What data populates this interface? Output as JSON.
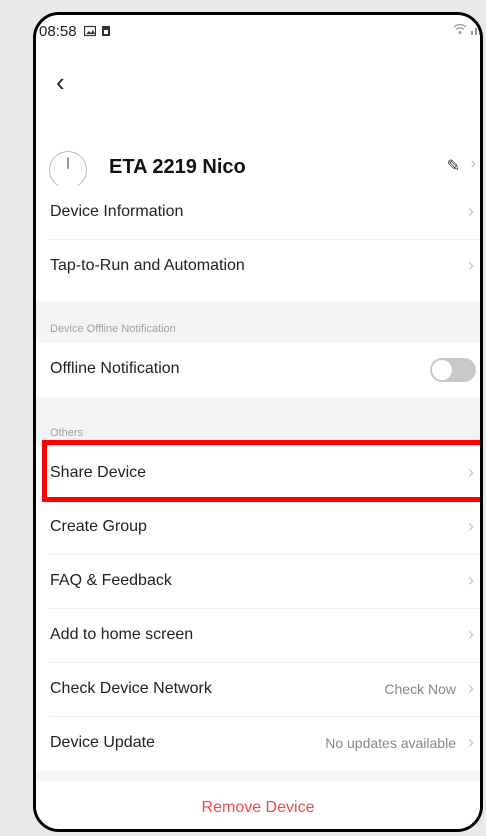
{
  "status_bar": {
    "time": "08:58"
  },
  "device": {
    "name": "ETA 2219 Nico"
  },
  "menu_top": [
    {
      "label": "Device Information"
    },
    {
      "label": "Tap-to-Run and Automation"
    }
  ],
  "section_offline": {
    "title": "Device Offline Notification",
    "item_label": "Offline Notification",
    "toggle_on": false
  },
  "section_others": {
    "title": "Others",
    "items": [
      {
        "label": "Share Device",
        "value": ""
      },
      {
        "label": "Create Group",
        "value": ""
      },
      {
        "label": "FAQ & Feedback",
        "value": ""
      },
      {
        "label": "Add to home screen",
        "value": ""
      },
      {
        "label": "Check Device Network",
        "value": "Check Now"
      },
      {
        "label": "Device Update",
        "value": "No updates available"
      }
    ]
  },
  "remove": {
    "label": "Remove Device"
  },
  "colors": {
    "highlight": "#ff0000",
    "danger": "#f04b4b",
    "toggle_off": "#c8c8c8"
  },
  "icons": [
    "back-icon",
    "edit-icon",
    "chevron-right-icon",
    "wifi-icon",
    "signal-icon",
    "image-icon",
    "sim-icon"
  ]
}
